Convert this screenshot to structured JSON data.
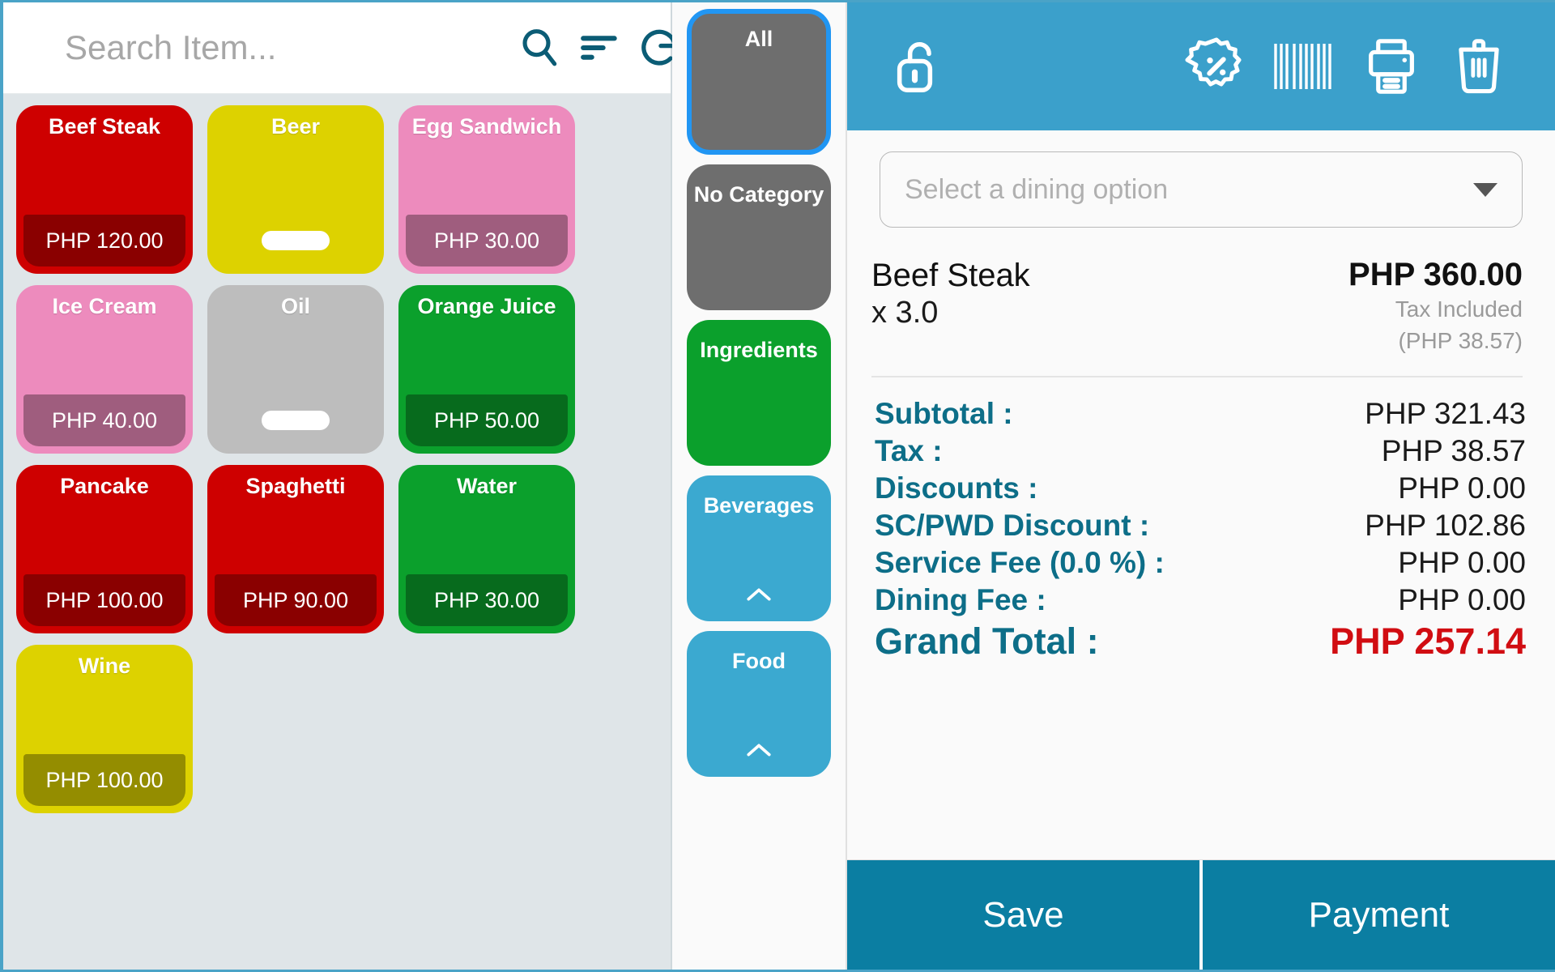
{
  "search": {
    "placeholder": "Search Item...",
    "value": "",
    "menu_icon": "hamburger-menu-icon",
    "search_icon": "search-icon",
    "sort_icon": "sort-icon",
    "refresh_icon": "refresh-icon"
  },
  "items": [
    {
      "name": "Beef Steak",
      "price": "PHP 120.00",
      "color": "#ce0000",
      "loading": false,
      "selected": true
    },
    {
      "name": "Beer",
      "price": "",
      "color": "#ddd200",
      "loading": true,
      "selected": false
    },
    {
      "name": "Egg Sandwich",
      "price": "PHP 30.00",
      "color": "#ed8bbd",
      "loading": false,
      "selected": false
    },
    {
      "name": "Ice Cream",
      "price": "PHP 40.00",
      "color": "#ed8bbd",
      "loading": false,
      "selected": false
    },
    {
      "name": "Oil",
      "price": "",
      "color": "#bdbdbd",
      "loading": true,
      "selected": false
    },
    {
      "name": "Orange Juice",
      "price": "PHP 50.00",
      "color": "#0ba02c",
      "loading": false,
      "selected": false
    },
    {
      "name": "Pancake",
      "price": "PHP 100.00",
      "color": "#ce0000",
      "loading": false,
      "selected": false
    },
    {
      "name": "Spaghetti",
      "price": "PHP 90.00",
      "color": "#ce0000",
      "loading": false,
      "selected": false
    },
    {
      "name": "Water",
      "price": "PHP 30.00",
      "color": "#0ba02c",
      "loading": false,
      "selected": false
    },
    {
      "name": "Wine",
      "price": "PHP 100.00",
      "color": "#ddd200",
      "loading": false,
      "selected": false
    }
  ],
  "categories": [
    {
      "label": "All",
      "color": "#6e6e6e",
      "active": true,
      "expandable": false
    },
    {
      "label": "No Category",
      "color": "#6e6e6e",
      "active": false,
      "expandable": false
    },
    {
      "label": "Ingredients",
      "color": "#0ba02c",
      "active": false,
      "expandable": false
    },
    {
      "label": "Beverages",
      "color": "#3ba9d0",
      "active": false,
      "expandable": true
    },
    {
      "label": "Food",
      "color": "#3ba9d0",
      "active": false,
      "expandable": true
    }
  ],
  "order": {
    "header_icons": [
      "unlock-icon",
      "discount-percent-icon",
      "barcode-icon",
      "printer-icon",
      "trash-icon"
    ],
    "dining": {
      "placeholder": "Select a dining option",
      "value": ""
    },
    "cart": [
      {
        "name": "Beef Steak",
        "qty": "x 3.0",
        "amount": "PHP 360.00",
        "tax_label": "Tax Included",
        "tax_amount": "(PHP 38.57)"
      }
    ],
    "totals": [
      {
        "label": "Subtotal :",
        "value": "PHP 321.43",
        "grand": false
      },
      {
        "label": "Tax :",
        "value": "PHP 38.57",
        "grand": false
      },
      {
        "label": "Discounts :",
        "value": "PHP 0.00",
        "grand": false
      },
      {
        "label": "SC/PWD Discount :",
        "value": "PHP 102.86",
        "grand": false
      },
      {
        "label": "Service Fee (0.0 %) :",
        "value": "PHP 0.00",
        "grand": false
      },
      {
        "label": "Dining Fee :",
        "value": "PHP 0.00",
        "grand": false
      },
      {
        "label": "Grand Total :",
        "value": "PHP 257.14",
        "grand": true
      }
    ],
    "actions": {
      "save_label": "Save",
      "payment_label": "Payment"
    }
  },
  "colors": {
    "header_blue": "#3ba0cb",
    "action_teal": "#0b7ea2",
    "accent_selected": "#2196f3",
    "label_teal": "#0d6e88",
    "grand_total_red": "#d10d12",
    "icon_dark_teal": "#0b5c75"
  }
}
